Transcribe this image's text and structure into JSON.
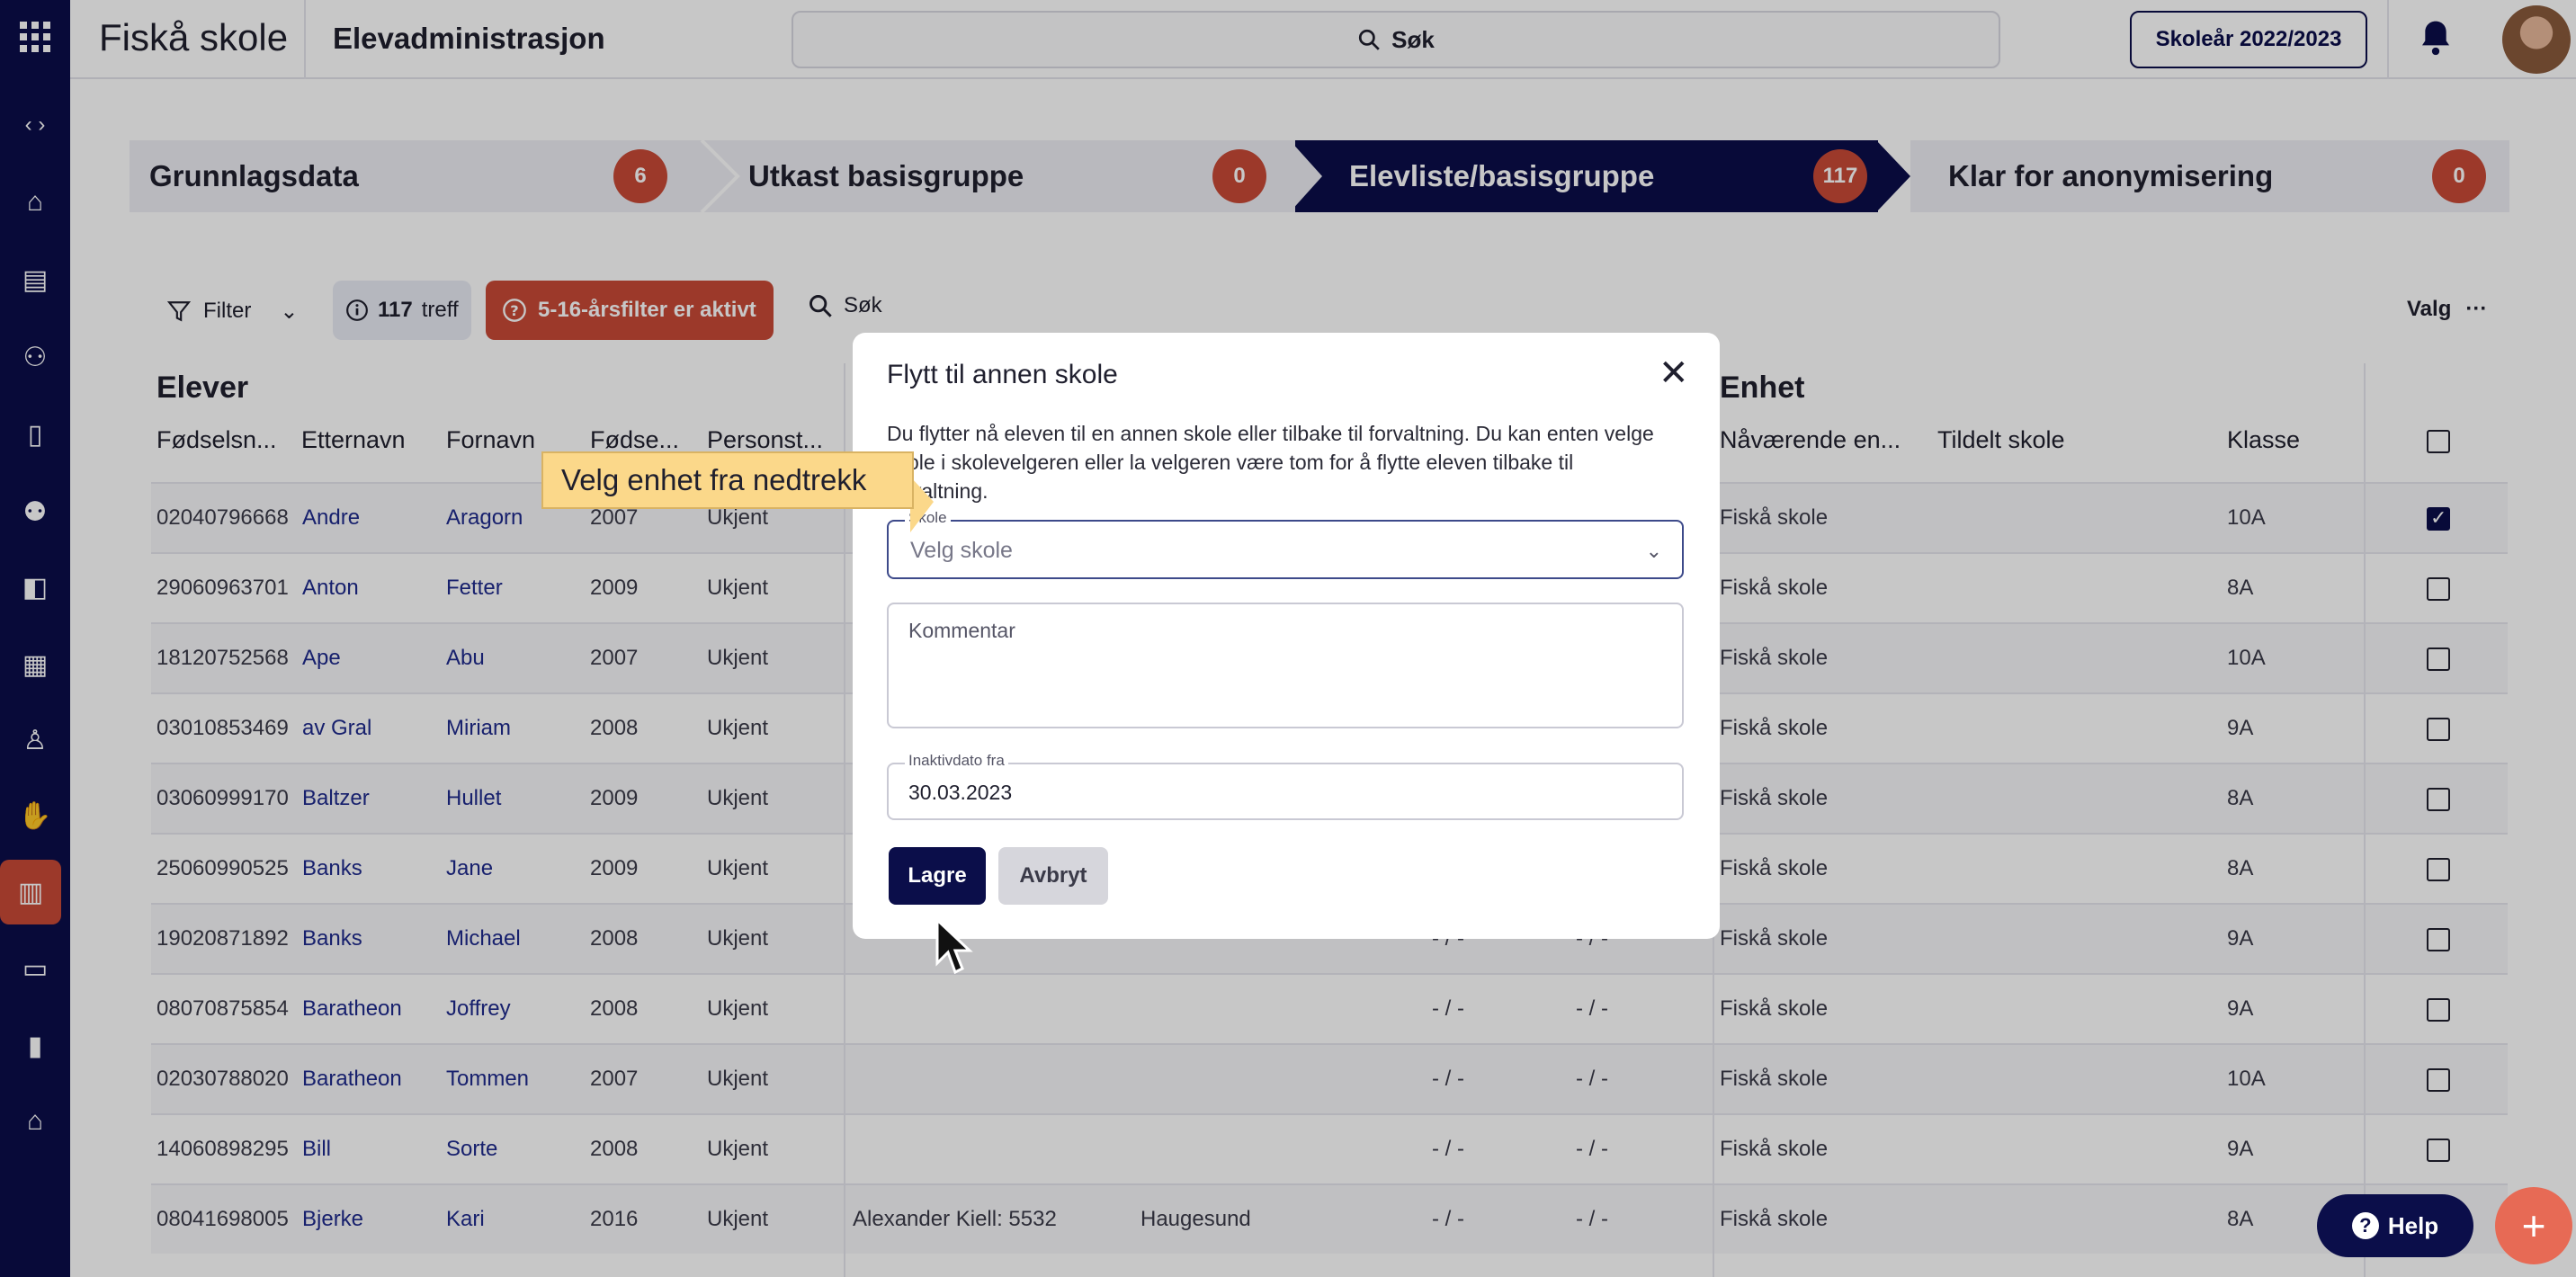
{
  "header": {
    "brand": "Fiskå skole",
    "app_title": "Elevadministrasjon",
    "search_label": "Søk",
    "year_button": "Skoleår 2022/2023"
  },
  "steps": [
    {
      "label": "Grunnlagsdata",
      "count": "6"
    },
    {
      "label": "Utkast basisgruppe",
      "count": "0"
    },
    {
      "label": "Elevliste/basisgruppe",
      "count": "117"
    },
    {
      "label": "Klar for anonymisering",
      "count": "0"
    }
  ],
  "toolbar": {
    "filter_label": "Filter",
    "hits_count": "117",
    "hits_label": "treff",
    "age_filter": "5-16-årsfilter er aktivt",
    "search_label": "Søk",
    "valg_label": "Valg"
  },
  "table": {
    "group_students": "Elever",
    "group_unit": "Enhet",
    "headers": [
      "Fødselsn...",
      "Etternavn",
      "Fornavn",
      "Fødse...",
      "Personst...",
      "Nåværende en...",
      "Tildelt skole",
      "Klasse"
    ],
    "rows": [
      {
        "nr": "02040796668",
        "last": "Andre",
        "first": "Aragorn",
        "year": "2007",
        "status": "Ukjent",
        "guardian": "",
        "city": "",
        "d1": "",
        "d2": "",
        "unit": "Fiskå skole",
        "klasse": "10A",
        "checked": true
      },
      {
        "nr": "29060963701",
        "last": "Anton",
        "first": "Fetter",
        "year": "2009",
        "status": "Ukjent",
        "guardian": "",
        "city": "",
        "d1": "",
        "d2": "",
        "unit": "Fiskå skole",
        "klasse": "8A",
        "checked": false
      },
      {
        "nr": "18120752568",
        "last": "Ape",
        "first": "Abu",
        "year": "2007",
        "status": "Ukjent",
        "guardian": "",
        "city": "",
        "d1": "",
        "d2": "",
        "unit": "Fiskå skole",
        "klasse": "10A",
        "checked": false
      },
      {
        "nr": "03010853469",
        "last": "av Gral",
        "first": "Miriam",
        "year": "2008",
        "status": "Ukjent",
        "guardian": "",
        "city": "",
        "d1": "",
        "d2": "",
        "unit": "Fiskå skole",
        "klasse": "9A",
        "checked": false
      },
      {
        "nr": "03060999170",
        "last": "Baltzer",
        "first": "Hullet",
        "year": "2009",
        "status": "Ukjent",
        "guardian": "",
        "city": "",
        "d1": "",
        "d2": "",
        "unit": "Fiskå skole",
        "klasse": "8A",
        "checked": false
      },
      {
        "nr": "25060990525",
        "last": "Banks",
        "first": "Jane",
        "year": "2009",
        "status": "Ukjent",
        "guardian": "",
        "city": "",
        "d1": "",
        "d2": "",
        "unit": "Fiskå skole",
        "klasse": "8A",
        "checked": false
      },
      {
        "nr": "19020871892",
        "last": "Banks",
        "first": "Michael",
        "year": "2008",
        "status": "Ukjent",
        "guardian": "",
        "city": "",
        "d1": "- / -",
        "d2": "- / -",
        "unit": "Fiskå skole",
        "klasse": "9A",
        "checked": false
      },
      {
        "nr": "08070875854",
        "last": "Baratheon",
        "first": "Joffrey",
        "year": "2008",
        "status": "Ukjent",
        "guardian": "",
        "city": "",
        "d1": "- / -",
        "d2": "- / -",
        "unit": "Fiskå skole",
        "klasse": "9A",
        "checked": false
      },
      {
        "nr": "02030788020",
        "last": "Baratheon",
        "first": "Tommen",
        "year": "2007",
        "status": "Ukjent",
        "guardian": "",
        "city": "",
        "d1": "- / -",
        "d2": "- / -",
        "unit": "Fiskå skole",
        "klasse": "10A",
        "checked": false
      },
      {
        "nr": "14060898295",
        "last": "Bill",
        "first": "Sorte",
        "year": "2008",
        "status": "Ukjent",
        "guardian": "",
        "city": "",
        "d1": "- / -",
        "d2": "- / -",
        "unit": "Fiskå skole",
        "klasse": "9A",
        "checked": false
      },
      {
        "nr": "08041698005",
        "last": "Bjerke",
        "first": "Kari",
        "year": "2016",
        "status": "Ukjent",
        "guardian": "Alexander Kiell: 5532",
        "city": "Haugesund",
        "d1": "- / -",
        "d2": "- / -",
        "unit": "Fiskå skole",
        "klasse": "8A",
        "checked": false
      }
    ]
  },
  "modal": {
    "title": "Flytt til annen skole",
    "description": "Du flytter nå eleven til en annen skole eller tilbake til forvaltning. Du kan enten velge skole i skolevelgeren eller la velgeren være tom for å flytte eleven tilbake til forvaltning.",
    "school_label": "Skole",
    "school_placeholder": "Velg skole",
    "comment_placeholder": "Kommentar",
    "date_label": "Inaktivdato fra",
    "date_value": "30.03.2023",
    "save_label": "Lagre",
    "cancel_label": "Avbryt"
  },
  "tooltip": "Velg enhet fra nedtrekk",
  "help_label": "Help",
  "colors": {
    "navy": "#0b0e4a",
    "accent_red": "#c84a37",
    "tooltip_yellow": "#fbd88a",
    "fab": "#e76a55"
  },
  "icons": [
    "apps-grid-icon",
    "code-icon",
    "home-icon",
    "news-icon",
    "people-icon",
    "badge-icon",
    "group-icon",
    "puzzle-icon",
    "calendar-icon",
    "person-icon",
    "hand-icon",
    "school-icon",
    "document-icon",
    "chart-icon",
    "building-icon",
    "search-icon",
    "bell-icon",
    "filter-icon",
    "info-icon",
    "warning-icon",
    "more-icon",
    "close-icon",
    "chevron-down-icon"
  ]
}
